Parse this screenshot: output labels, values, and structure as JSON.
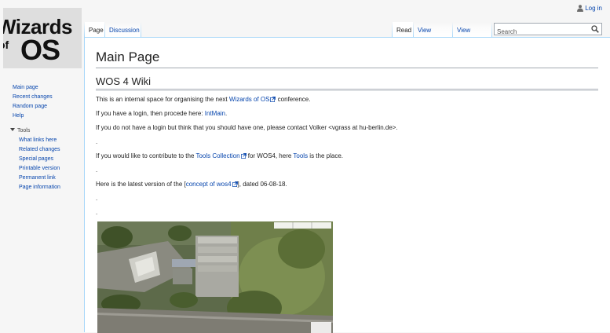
{
  "personal": {
    "login": "Log in"
  },
  "logo": {
    "line1": "Wizards",
    "line2": "of",
    "line3": "OS"
  },
  "tabs": {
    "page": "Page",
    "discussion": "Discussion",
    "read": "Read",
    "view_source": "View source",
    "view_history": "View history"
  },
  "search": {
    "placeholder": "Search"
  },
  "sidebar": {
    "navigation": [
      "Main page",
      "Recent changes",
      "Random page",
      "Help"
    ],
    "tools_header": "Tools",
    "tools": [
      "What links here",
      "Related changes",
      "Special pages",
      "Printable version",
      "Permanent link",
      "Page information"
    ]
  },
  "content": {
    "title": "Main Page",
    "section_heading": "WOS 4 Wiki",
    "p1": {
      "before": "This is an internal space for organising the next ",
      "link": "Wizards of OS",
      "after": " conference."
    },
    "p2": {
      "before": "If you have a login, then procede here: ",
      "link": "IntMain",
      "after": "."
    },
    "p3": {
      "text": "If you do not have a login but think that you should have one, please contact Volker <vgrass at hu-berlin.de>."
    },
    "dot1": ".",
    "p4": {
      "before": "If you would like to contribute to the ",
      "link1": "Tools Collection",
      "middle": " for WOS4, here ",
      "link2": "Tools",
      "after": " is the place."
    },
    "dot2": ".",
    "p5": {
      "before": "Here is the latest version of the [",
      "link": "concept of wos4",
      "after": "], dated 06-08-18."
    },
    "dot3": ".",
    "dot4": "."
  },
  "colors": {
    "link": "#0645ad",
    "border": "#a7d7f9",
    "sidebar_bg": "#f6f6f6"
  },
  "icons": {
    "user": "user-icon",
    "search": "magnifier-icon",
    "external": "external-link-icon",
    "tools_toggle": "triangle-down-icon"
  }
}
